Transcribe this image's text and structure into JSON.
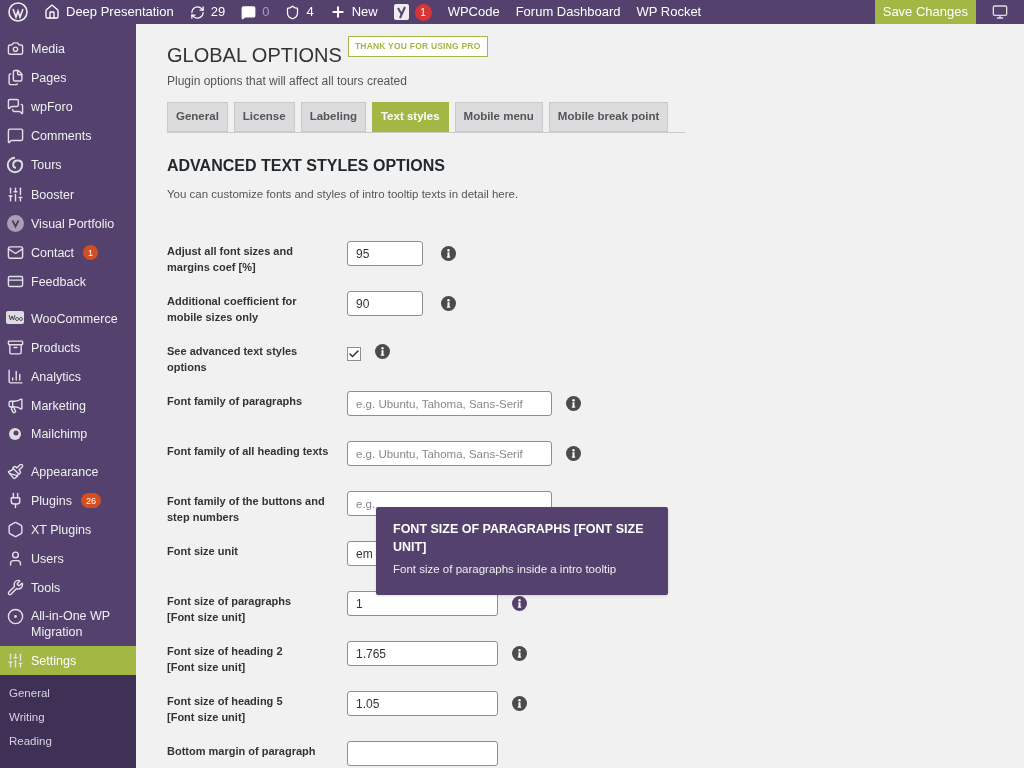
{
  "admin_bar": {
    "items": [
      {
        "kind": "wp-logo"
      },
      {
        "kind": "site",
        "label": "Deep Presentation"
      },
      {
        "kind": "updates",
        "label": "29"
      },
      {
        "kind": "comments",
        "label": "0"
      },
      {
        "kind": "shield",
        "label": "4"
      },
      {
        "kind": "new",
        "label": "New"
      },
      {
        "kind": "yoast",
        "badge": "1"
      },
      {
        "kind": "link",
        "label": "WPCode"
      },
      {
        "kind": "link",
        "label": "Forum Dashboard"
      },
      {
        "kind": "link",
        "label": "WP Rocket"
      }
    ],
    "save_button": "Save Changes"
  },
  "sidebar": {
    "items": [
      {
        "kind": "media",
        "label": "Media",
        "selected": false
      },
      {
        "kind": "pages",
        "label": "Pages",
        "selected": false
      },
      {
        "kind": "forum",
        "label": "wpForo",
        "selected": false
      },
      {
        "kind": "comments",
        "label": "Comments",
        "selected": false
      },
      {
        "kind": "tours",
        "label": "Tours",
        "selected": false
      },
      {
        "kind": "booster",
        "label": "Booster",
        "selected": false
      },
      {
        "kind": "portfolio",
        "label": "Visual Portfolio",
        "selected": false
      },
      {
        "kind": "contact",
        "label": "Contact",
        "badge": "1",
        "selected": false
      },
      {
        "kind": "feedback",
        "label": "Feedback",
        "selected": false
      },
      {
        "kind": "separator"
      },
      {
        "kind": "woo",
        "label": "WooCommerce",
        "selected": false
      },
      {
        "kind": "products",
        "label": "Products",
        "selected": false
      },
      {
        "kind": "analytics",
        "label": "Analytics",
        "selected": false
      },
      {
        "kind": "marketing",
        "label": "Marketing",
        "selected": false
      },
      {
        "kind": "mailchimp",
        "label": "Mailchimp",
        "selected": false
      },
      {
        "kind": "separator"
      },
      {
        "kind": "appearance",
        "label": "Appearance",
        "selected": false
      },
      {
        "kind": "plugins",
        "label": "Plugins",
        "badge": "26",
        "selected": false
      },
      {
        "kind": "xt",
        "label": "XT Plugins",
        "selected": false
      },
      {
        "kind": "users",
        "label": "Users",
        "selected": false
      },
      {
        "kind": "tools",
        "label": "Tools",
        "selected": false
      },
      {
        "kind": "migration",
        "label": "All-in-One WP Migration",
        "selected": false
      },
      {
        "kind": "settings",
        "label": "Settings",
        "selected": true
      }
    ],
    "submenu": [
      {
        "label": "General"
      },
      {
        "label": "Writing"
      },
      {
        "label": "Reading"
      }
    ]
  },
  "page": {
    "title": "GLOBAL OPTIONS",
    "pro_badge": "THANK YOU FOR USING PRO",
    "subtitle": "Plugin options that will affect all tours created",
    "tabs": [
      {
        "label": "General",
        "selected": false
      },
      {
        "label": "License",
        "selected": false
      },
      {
        "label": "Labeling",
        "selected": false
      },
      {
        "label": "Text styles",
        "selected": true
      },
      {
        "label": "Mobile menu",
        "selected": false
      },
      {
        "label": "Mobile break point",
        "selected": false
      }
    ],
    "section_title": "ADVANCED TEXT STYLES OPTIONS",
    "section_description": "You can customize fonts and styles of intro tooltip texts in detail here.",
    "options": [
      {
        "kind": "number",
        "label": "Adjust all font sizes and margins coef [%]",
        "value": "95",
        "info_active": false
      },
      {
        "kind": "number",
        "label": "Additional coefficient for mobile sizes only",
        "value": "90",
        "info_active": false
      },
      {
        "kind": "checkbox",
        "label": "See advanced text styles options",
        "checked": true,
        "info_active": false
      },
      {
        "kind": "text",
        "label": "Font family of paragraphs",
        "placeholder": "e.g. Ubuntu, Tahoma, Sans-Serif",
        "info_active": false
      },
      {
        "kind": "text",
        "label": "Font family of all heading texts",
        "placeholder": "e.g. Ubuntu, Tahoma, Sans-Serif",
        "info_active": false
      },
      {
        "kind": "text",
        "label": "Font family of the buttons and step numbers",
        "placeholder": "e.g."
      },
      {
        "kind": "select",
        "label": "Font size unit",
        "value": "em"
      },
      {
        "kind": "size",
        "label": "Font size of paragraphs",
        "unit": "[Font size unit]",
        "value": "1",
        "info_active": true
      },
      {
        "kind": "size",
        "label": "Font size of heading 2",
        "unit": "[Font size unit]",
        "value": "1.765",
        "info_active": false
      },
      {
        "kind": "size",
        "label": "Font size of heading 5",
        "unit": "[Font size unit]",
        "value": "1.05",
        "info_active": false
      },
      {
        "kind": "size",
        "label": "Bottom margin of paragraph"
      }
    ],
    "tooltip": {
      "title": "FONT SIZE OF PARAGRAPHS [FONT SIZE UNIT]",
      "text": "Font size of paragraphs inside a intro tooltip"
    }
  }
}
